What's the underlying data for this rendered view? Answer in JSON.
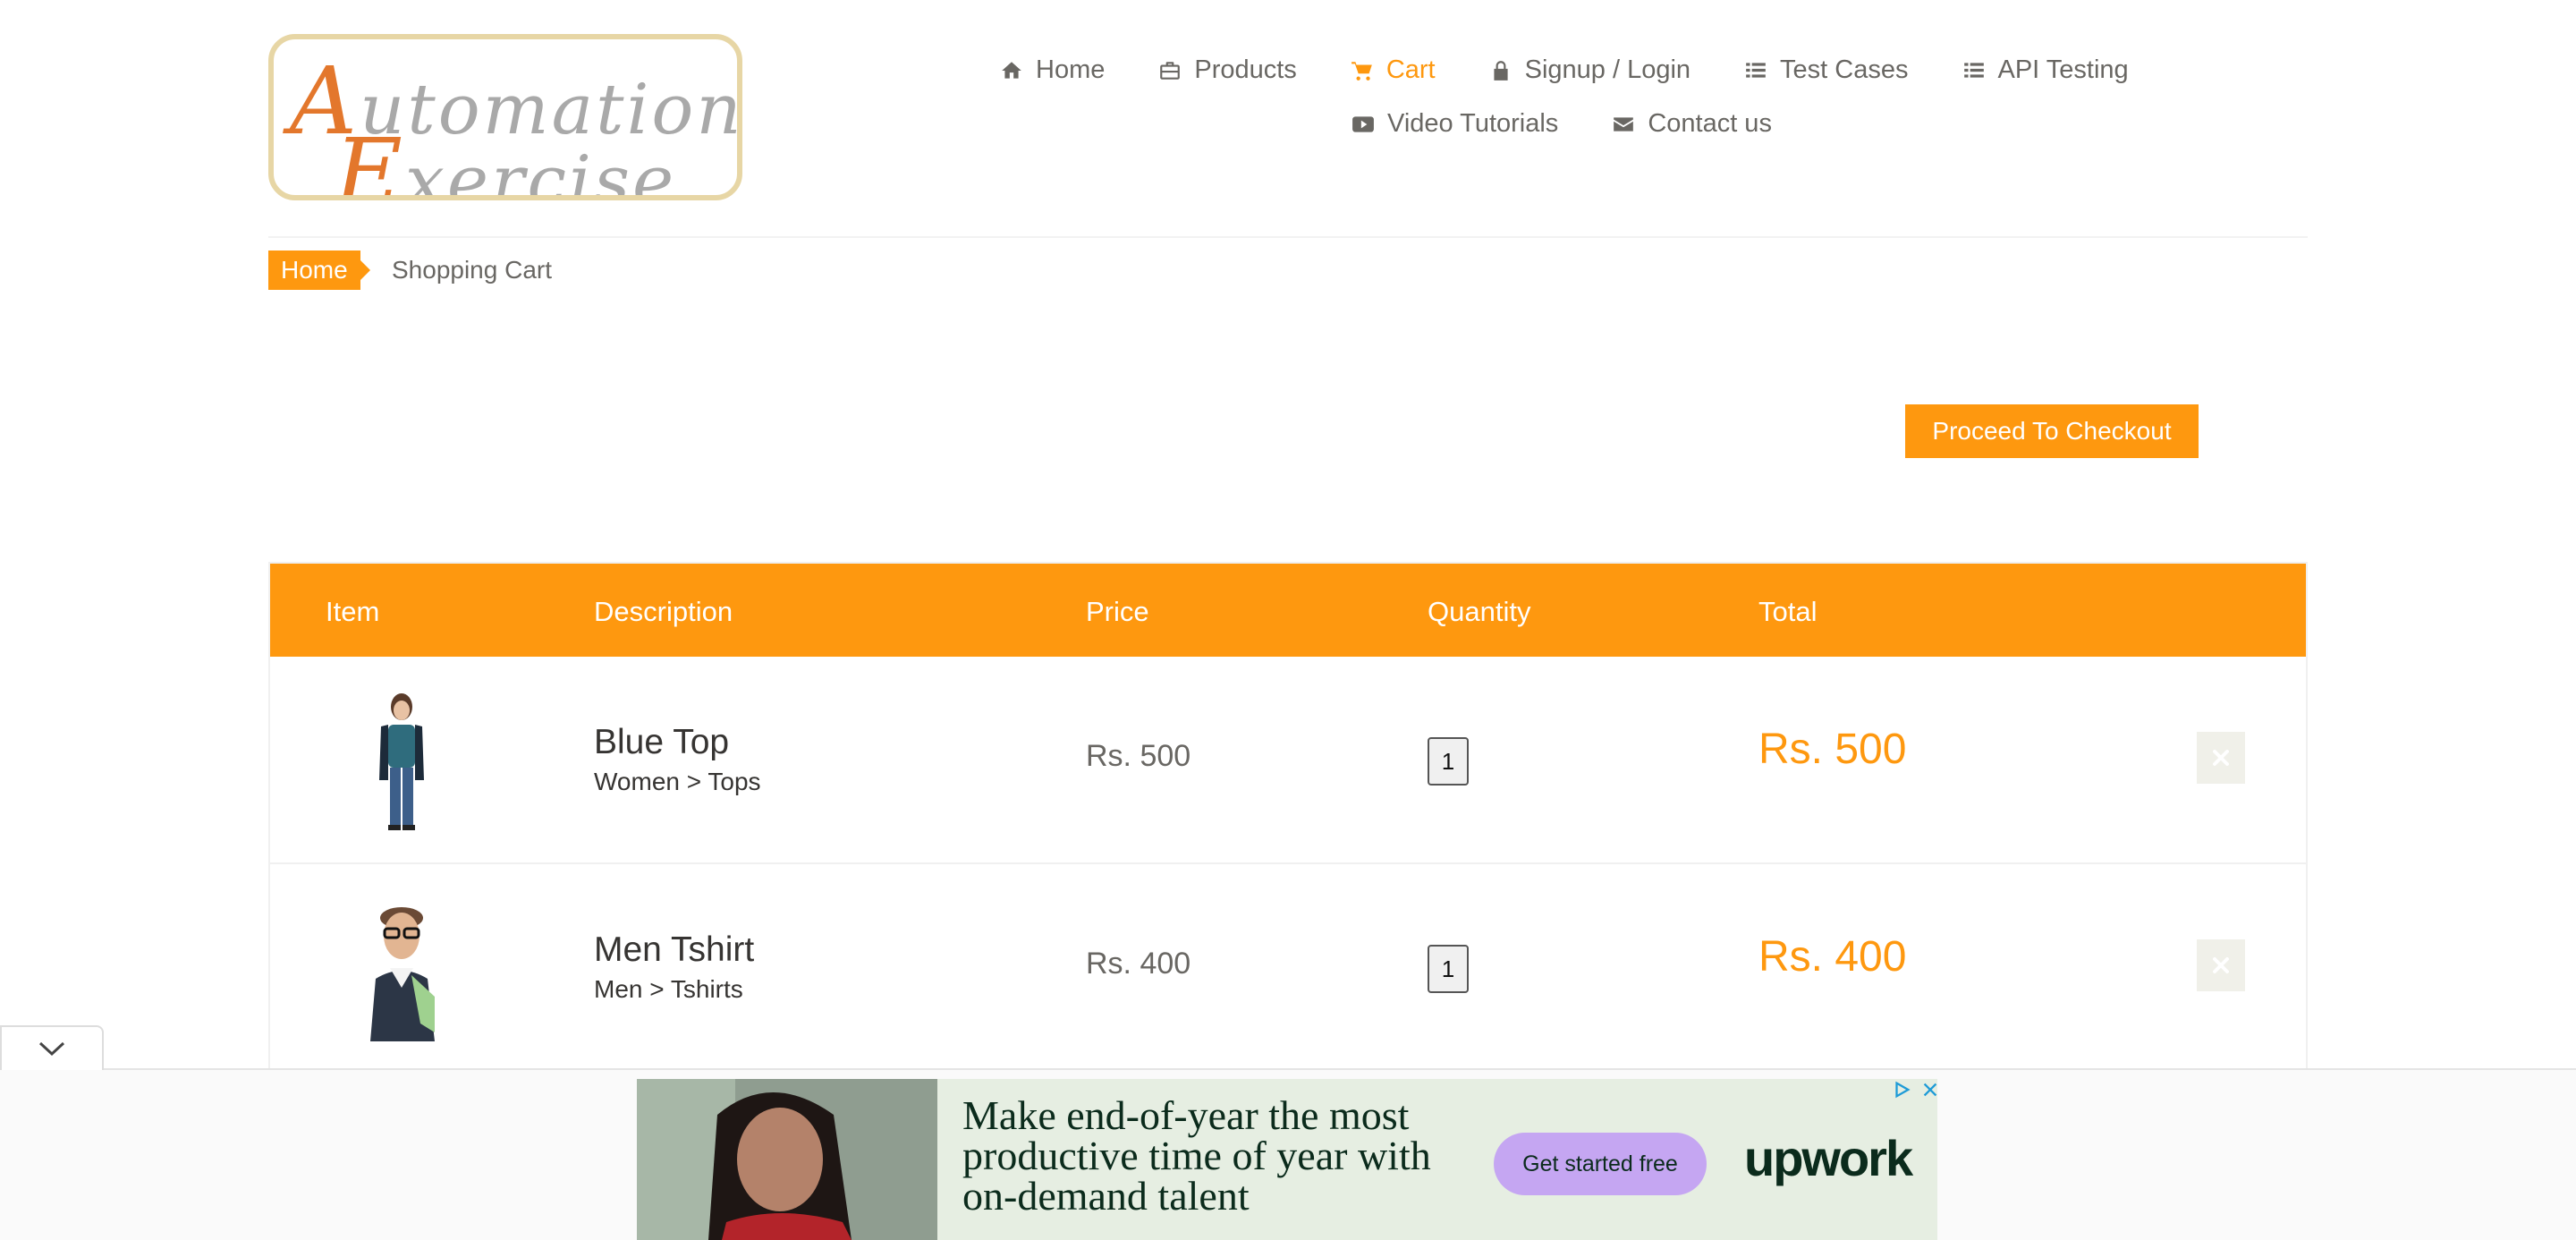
{
  "header": {
    "logo": {
      "line1": "Automation",
      "line2": "Exercise",
      "alt": "Website for automation practice"
    },
    "nav_row1": [
      {
        "label": "Home",
        "icon": "home-icon"
      },
      {
        "label": "Products",
        "icon": "briefcase-icon"
      },
      {
        "label": "Cart",
        "icon": "shopping-cart-icon",
        "active": true
      },
      {
        "label": "Signup / Login",
        "icon": "lock-icon"
      },
      {
        "label": "Test Cases",
        "icon": "list-icon"
      },
      {
        "label": "API Testing",
        "icon": "list-icon"
      }
    ],
    "nav_row2": [
      {
        "label": "Video Tutorials",
        "icon": "youtube-play-icon"
      },
      {
        "label": "Contact us",
        "icon": "envelope-icon"
      }
    ]
  },
  "breadcrumb": {
    "home": "Home",
    "current": "Shopping Cart"
  },
  "checkout_button": "Proceed To Checkout",
  "cart_table": {
    "columns": [
      "Item",
      "Description",
      "Price",
      "Quantity",
      "Total"
    ],
    "rows": [
      {
        "name": "Blue Top",
        "category": "Women > Tops",
        "price": "Rs. 500",
        "quantity": "1",
        "total": "Rs. 500"
      },
      {
        "name": "Men Tshirt",
        "category": "Men > Tshirts",
        "price": "Rs. 400",
        "quantity": "1",
        "total": "Rs. 400"
      }
    ]
  },
  "ad": {
    "headline": [
      "Make end-of-year the most",
      "productive time of year with",
      "on-demand talent"
    ],
    "cta": "Get started free",
    "brand": "upwork"
  },
  "colors": {
    "accent": "#fe980f",
    "text": "#696763",
    "dark_text": "#363432"
  }
}
